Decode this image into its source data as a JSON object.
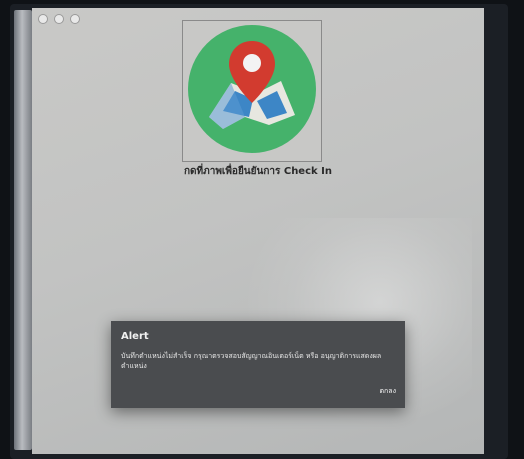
{
  "checkin": {
    "caption": "กดที่ภาพเพื่อยืนยันการ Check In",
    "icon": "map-location-pin-icon",
    "colors": {
      "circle": "#45b26b",
      "pin": "#d23b2f",
      "map_light": "#e7e7e0",
      "map_blue": "#3d86c6"
    }
  },
  "alert": {
    "title": "Alert",
    "message": "บันทึกตำแหน่งไม่สำเร็จ กรุณาตรวจสอบสัญญาณอินเตอร์เน็ต หรือ อนุญาติการแสดงผลตำแหน่ง",
    "ok_label": "ตกลง"
  }
}
